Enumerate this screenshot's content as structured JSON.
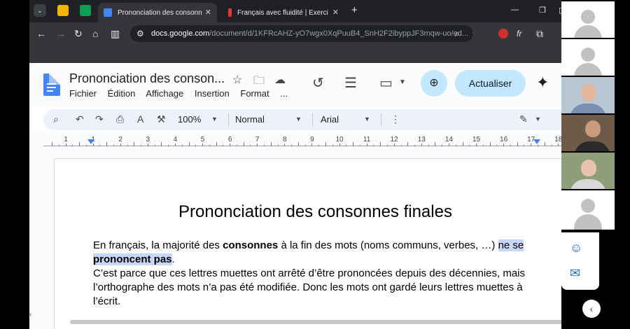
{
  "browser": {
    "tabs": [
      {
        "title": "Prononciation des consonnes fi",
        "active": true,
        "favicon_color": "#4285f4"
      },
      {
        "title": "Français avec fluidité | Exercice",
        "active": false,
        "favicon_color": "#e53935"
      }
    ],
    "url_domain": "docs.google.com",
    "url_path": "/document/d/1KFRcAHZ-yO7wgx0XqPuuB4_SnH2F2ibyppJF3mqw-uo/ed..."
  },
  "doc": {
    "title": "Prononciation des conson...",
    "menu": [
      "Fichier",
      "Édition",
      "Affichage",
      "Insertion",
      "Format",
      "..."
    ],
    "update_button": "Actualiser",
    "toolbar": {
      "zoom": "100%",
      "style": "Normal",
      "font": "Arial"
    },
    "ruler": [
      "1",
      "1",
      "2",
      "3",
      "4",
      "5",
      "6",
      "7",
      "8",
      "9",
      "10",
      "11",
      "12",
      "13",
      "14",
      "15",
      "16",
      "17",
      "18"
    ],
    "heading": "Prononciation des consonnes finales",
    "para1": {
      "t1": "En français, la majorité des ",
      "b1": "consonnes",
      "t2": " à la fin des mots (noms communs, verbes, …) ",
      "hl1": "ne se ",
      "hl2": "prononcent pas",
      "t3": "."
    },
    "para2": "C’est parce que ces lettres muettes ont arrêté d’être prononcées depuis des décennies, mais l’orthographe des mots n’a pas été modifiée. Donc les mots ont gardé leurs lettres muettes à l’écrit.",
    "highlight_color": "#c6d7f8"
  },
  "icons": {
    "search": "magnifier-icon",
    "undo": "undo-icon",
    "redo": "redo-icon",
    "print": "print-icon",
    "spellcheck": "spellcheck-icon",
    "paint": "paint-format-icon",
    "more": "more-vert-icon",
    "edit": "pencil-icon",
    "history": "history-icon",
    "comments": "comment-icon",
    "meet": "video-icon",
    "share": "add-person-icon",
    "gemini": "sparkle-icon",
    "emoji": "emoji-icon",
    "feedback": "feedback-icon"
  }
}
